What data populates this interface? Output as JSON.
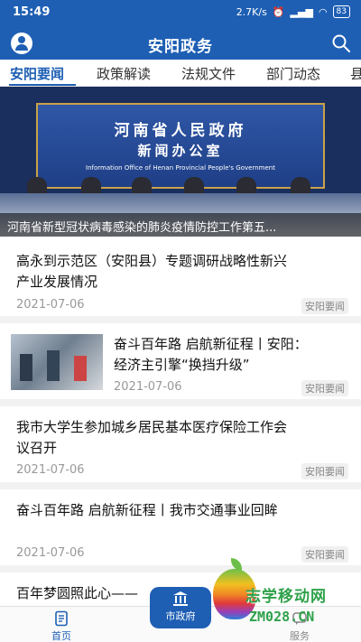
{
  "status_bar": {
    "time": "15:49",
    "network_speed": "2.7K/s",
    "battery": "83"
  },
  "app_bar": {
    "title": "安阳政务"
  },
  "tabs": [
    {
      "label": "安阳要闻",
      "active": true
    },
    {
      "label": "政策解读",
      "active": false
    },
    {
      "label": "法规文件",
      "active": false
    },
    {
      "label": "部门动态",
      "active": false
    },
    {
      "label": "县",
      "active": false
    }
  ],
  "banner": {
    "wall_line1": "河南省人民政府",
    "wall_line2": "新闻办公室",
    "wall_line3": "Information Office of Henan Provincial People's Government",
    "caption": "河南省新型冠状病毒感染的肺炎疫情防控工作第五..."
  },
  "news": [
    {
      "headline_line1": "高永到示范区（安阳县）专题调研战略性新兴",
      "headline_line2": "产业发展情况",
      "date": "2021-07-06",
      "tag": "安阳要闻"
    },
    {
      "headline_line1": "奋斗百年路 启航新征程丨安阳：",
      "headline_line2": "经济主引擎“换挡升级”",
      "date": "2021-07-06",
      "tag": "安阳要闻"
    },
    {
      "headline_line1": "我市大学生参加城乡居民基本医疗保险工作会",
      "headline_line2": "议召开",
      "date": "2021-07-06",
      "tag": "安阳要闻"
    },
    {
      "headline_line1": "奋斗百年路 启航新征程丨我市交通事业回眸",
      "headline_line2": "",
      "date": "2021-07-06",
      "tag": "安阳要闻"
    },
    {
      "headline_line1": "百年梦圆照此心——",
      "headline_line2": "",
      "date": "",
      "tag": ""
    }
  ],
  "bottom_nav": {
    "home": "首页",
    "center": "市政府",
    "services": "服务"
  },
  "watermark": {
    "cn": "志学移动网",
    "en": "ZM028.CN"
  },
  "colors": {
    "brand": "#1e5fb4",
    "watermark_green": "#2fa14a"
  }
}
